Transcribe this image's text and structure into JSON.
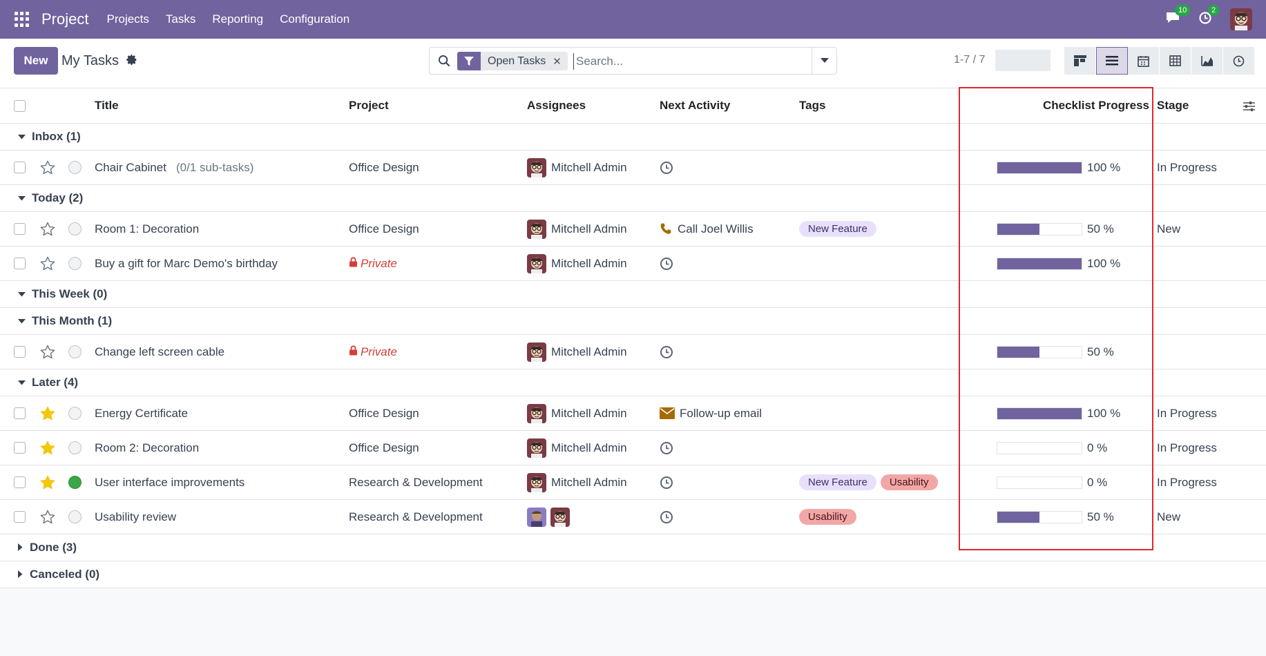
{
  "topbar": {
    "app_name": "Project",
    "menu": [
      "Projects",
      "Tasks",
      "Reporting",
      "Configuration"
    ],
    "messages_badge": "10",
    "activities_badge": "2"
  },
  "controlbar": {
    "new_label": "New",
    "page_title": "My Tasks",
    "facet_label": "Open Tasks",
    "search_placeholder": "Search...",
    "pager": "1-7 / 7"
  },
  "columns": {
    "title": "Title",
    "project": "Project",
    "assignees": "Assignees",
    "next_activity": "Next Activity",
    "tags": "Tags",
    "checklist_progress": "Checklist Progress",
    "stage": "Stage"
  },
  "groups": [
    {
      "label": "Inbox (1)",
      "open": true,
      "rows": [
        {
          "title": "Chair Cabinet",
          "subtasks": "(0/1 sub-tasks)",
          "starred": false,
          "status": "normal",
          "project": "Office Design",
          "private": false,
          "assignees": [
            "Mitchell Admin"
          ],
          "assignee_label": "Mitchell Admin",
          "activity_icon": "clock-icon",
          "activity_text": "",
          "tags": [],
          "progress": 100,
          "progress_label": "100 %",
          "stage": "In Progress"
        }
      ]
    },
    {
      "label": "Today (2)",
      "open": true,
      "rows": [
        {
          "title": "Room 1: Decoration",
          "subtasks": "",
          "starred": false,
          "status": "normal",
          "project": "Office Design",
          "private": false,
          "assignees": [
            "Mitchell Admin"
          ],
          "assignee_label": "Mitchell Admin",
          "activity_icon": "phone-icon",
          "activity_text": "Call Joel Willis",
          "tags": [
            "New Feature"
          ],
          "progress": 50,
          "progress_label": "50 %",
          "stage": "New"
        },
        {
          "title": "Buy a gift for Marc Demo's birthday",
          "subtasks": "",
          "starred": false,
          "status": "normal",
          "project": "Private",
          "private": true,
          "assignees": [
            "Mitchell Admin"
          ],
          "assignee_label": "Mitchell Admin",
          "activity_icon": "clock-icon",
          "activity_text": "",
          "tags": [],
          "progress": 100,
          "progress_label": "100 %",
          "stage": ""
        }
      ]
    },
    {
      "label": "This Week (0)",
      "open": true,
      "rows": []
    },
    {
      "label": "This Month (1)",
      "open": true,
      "rows": [
        {
          "title": "Change left screen cable",
          "subtasks": "",
          "starred": false,
          "status": "normal",
          "project": "Private",
          "private": true,
          "assignees": [
            "Mitchell Admin"
          ],
          "assignee_label": "Mitchell Admin",
          "activity_icon": "clock-icon",
          "activity_text": "",
          "tags": [],
          "progress": 50,
          "progress_label": "50 %",
          "stage": ""
        }
      ]
    },
    {
      "label": "Later (4)",
      "open": true,
      "rows": [
        {
          "title": "Energy Certificate",
          "subtasks": "",
          "starred": true,
          "status": "normal",
          "project": "Office Design",
          "private": false,
          "assignees": [
            "Mitchell Admin"
          ],
          "assignee_label": "Mitchell Admin",
          "activity_icon": "envelope-icon",
          "activity_text": "Follow-up email",
          "tags": [],
          "progress": 100,
          "progress_label": "100 %",
          "stage": "In Progress"
        },
        {
          "title": "Room 2: Decoration",
          "subtasks": "",
          "starred": true,
          "status": "normal",
          "project": "Office Design",
          "private": false,
          "assignees": [
            "Mitchell Admin"
          ],
          "assignee_label": "Mitchell Admin",
          "activity_icon": "clock-icon",
          "activity_text": "",
          "tags": [],
          "progress": 0,
          "progress_label": "0 %",
          "stage": "In Progress"
        },
        {
          "title": "User interface improvements",
          "subtasks": "",
          "starred": true,
          "status": "done",
          "project": "Research & Development",
          "private": false,
          "assignees": [
            "Mitchell Admin"
          ],
          "assignee_label": "Mitchell Admin",
          "activity_icon": "clock-icon",
          "activity_text": "",
          "tags": [
            "New Feature",
            "Usability"
          ],
          "progress": 0,
          "progress_label": "0 %",
          "stage": "In Progress"
        },
        {
          "title": "Usability review",
          "subtasks": "",
          "starred": false,
          "status": "normal",
          "project": "Research & Development",
          "private": false,
          "assignees": [
            "user-2",
            "Mitchell Admin"
          ],
          "assignee_label": "",
          "activity_icon": "clock-icon",
          "activity_text": "",
          "tags": [
            "Usability"
          ],
          "progress": 50,
          "progress_label": "50 %",
          "stage": "New"
        }
      ]
    },
    {
      "label": "Done (3)",
      "open": false,
      "rows": []
    },
    {
      "label": "Canceled (0)",
      "open": false,
      "rows": []
    }
  ],
  "colors": {
    "brand": "#71639e",
    "star": "#f3c70b",
    "private": "#d23f3a",
    "highlight": "#e0252d"
  }
}
